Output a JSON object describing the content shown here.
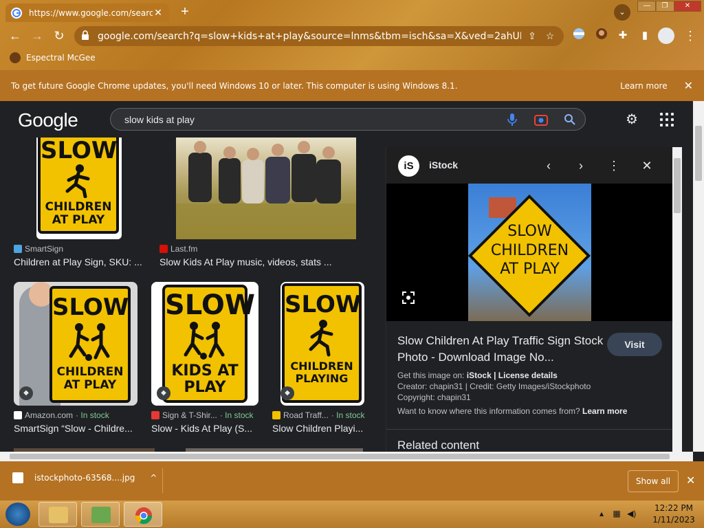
{
  "browser": {
    "tab_title": "https://www.google.com/search?",
    "new_tab": "+",
    "omnibox_url": "google.com/search?q=slow+kids+at+play&source=lnms&tbm=isch&sa=X&ved=2ahUKEwjByZD...",
    "bookmark_label": "Espectral McGee"
  },
  "update_bar": {
    "message": "To get future Google Chrome updates, you'll need Windows 10 or later. This computer is using Windows 8.1.",
    "learn_more": "Learn more"
  },
  "google": {
    "logo": "Google",
    "query": "slow kids at play"
  },
  "results": [
    {
      "source": "SmartSign",
      "title": "Children at Play Sign, SKU: ...",
      "stock": ""
    },
    {
      "source": "Last.fm",
      "title": "Slow Kids At Play music, videos, stats ...",
      "stock": ""
    },
    {
      "source": "Amazon.com",
      "title": "SmartSign “Slow - Childre...",
      "stock": "In stock",
      "sep": "·"
    },
    {
      "source": "Sign & T-Shir...",
      "title": "Slow - Kids At Play (S...",
      "stock": "In stock",
      "sep": "·"
    },
    {
      "source": "Road Traff...",
      "title": "Slow Children Playi...",
      "stock": "In stock",
      "sep": "·"
    }
  ],
  "signs": {
    "r1": {
      "line1": "SLOW",
      "line2": "CHILDREN",
      "line3": "AT PLAY"
    },
    "r3": {
      "line1": "SLOW",
      "line2": "CHILDREN",
      "line3": "AT PLAY"
    },
    "r4": {
      "line1": "SLOW",
      "line2": "KIDS AT",
      "line3": "PLAY"
    },
    "r5": {
      "line1": "SLOW",
      "line2": "CHILDREN",
      "line3": "PLAYING"
    }
  },
  "panel": {
    "logo": "iS",
    "site_name": "iStock",
    "photo_sign": {
      "line1": "SLOW",
      "line2": "CHILDREN",
      "line3": "AT PLAY"
    },
    "title": "Slow Children At Play Traffic Sign Stock Photo - Download Image No...",
    "visit_label": "Visit",
    "get_image_prefix": "Get this image on:",
    "get_image_site": "iStock",
    "separator": "|",
    "license": "License details",
    "creator": "Creator: chapin31 | Credit: Getty Images/iStockphoto",
    "copyright": "Copyright: chapin31",
    "want_to_know": "Want to know where this information comes from?",
    "learn_more": "Learn more",
    "related": "Related content"
  },
  "downloads": {
    "file_name": "istockphoto-63568....jpg",
    "show_all": "Show all"
  },
  "taskbar": {
    "time": "12:22 PM",
    "date": "1/11/2023"
  },
  "colors": {
    "chrome_theme": "#b57222",
    "page_bg": "#202124",
    "in_stock": "#81c995",
    "sign_yellow": "#f2c200"
  }
}
